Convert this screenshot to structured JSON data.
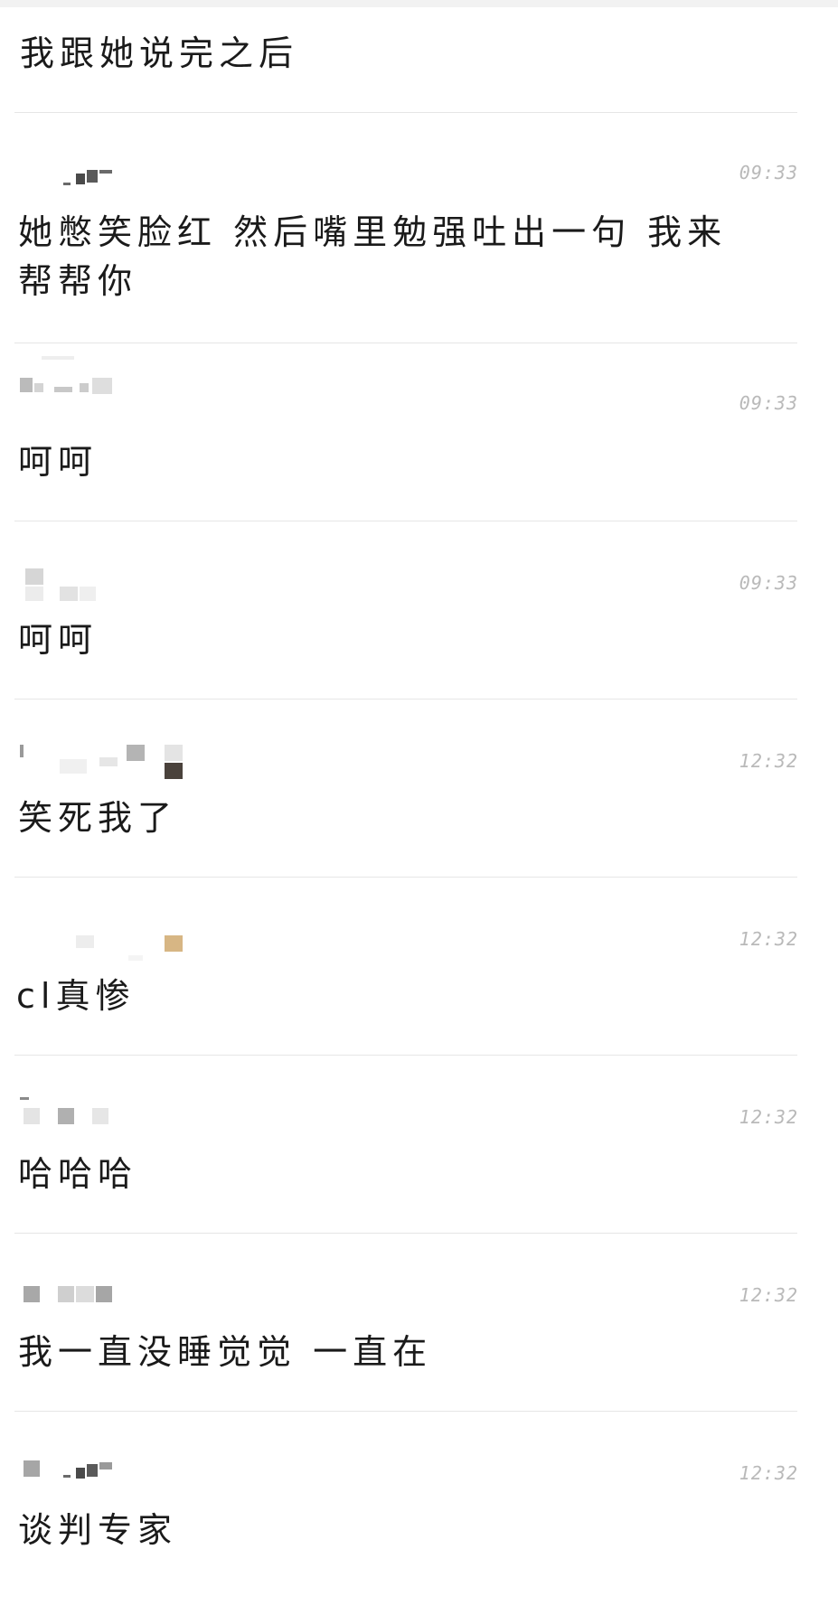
{
  "thread": {
    "top_text": "我跟她说完之后"
  },
  "messages": [
    {
      "time": "09:33",
      "text": "她憋笑脸红 然后嘴里勉强吐出一句 我来帮帮你"
    },
    {
      "time": "09:33",
      "text": "呵呵"
    },
    {
      "time": "09:33",
      "text": "呵呵"
    },
    {
      "time": "12:32",
      "text": "笑死我了"
    },
    {
      "time": "12:32",
      "text": "cl真惨"
    },
    {
      "time": "12:32",
      "text": "哈哈哈"
    },
    {
      "time": "12:32",
      "text": "我一直没睡觉觉 一直在"
    },
    {
      "time": "12:32",
      "text": "谈判专家"
    }
  ]
}
